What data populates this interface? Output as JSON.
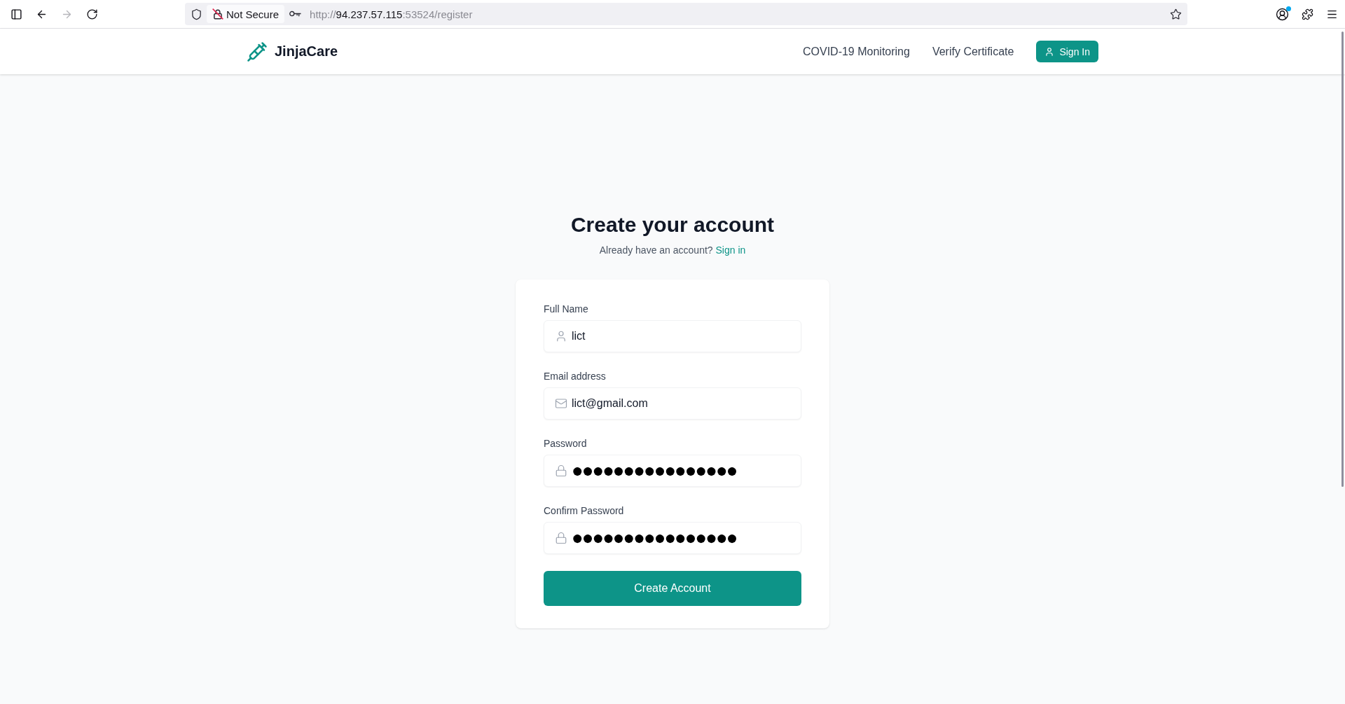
{
  "browser": {
    "back_button": {
      "disabled": false
    },
    "forward_button": {
      "disabled": true
    },
    "security_label": "Not Secure",
    "url": {
      "scheme": "http://",
      "host": "94.237.57.115",
      "rest": ":53524/register"
    },
    "account_button": {
      "notification": true
    }
  },
  "navbar": {
    "brand": "JinjaCare",
    "links": [
      {
        "label": "COVID-19 Monitoring"
      },
      {
        "label": "Verify Certificate"
      }
    ],
    "sign_in_button": "Sign In"
  },
  "register": {
    "title": "Create your account",
    "prompt": "Already have an account?",
    "prompt_link": "Sign in",
    "fields": [
      {
        "label": "Full Name",
        "kind": "name",
        "value": "lict"
      },
      {
        "label": "Email address",
        "kind": "email",
        "value": "lict@gmail.com"
      },
      {
        "label": "Password",
        "kind": "password",
        "value": "●●●●●●●●●●●●●●●●"
      },
      {
        "label": "Confirm Password",
        "kind": "password",
        "value": "●●●●●●●●●●●●●●●●"
      }
    ],
    "submit_button": "Create Account"
  }
}
